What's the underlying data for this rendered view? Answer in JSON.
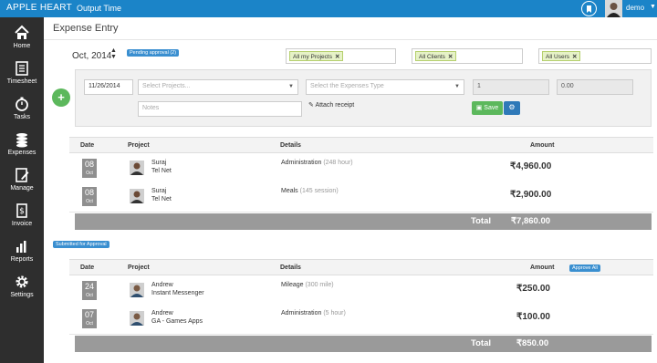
{
  "topbar": {
    "brand": "APPLE HEART",
    "subtitle": "Output Time",
    "user": "demo"
  },
  "sidebar": [
    {
      "label": "Home",
      "icon": "home-icon"
    },
    {
      "label": "Timesheet",
      "icon": "timesheet-icon"
    },
    {
      "label": "Tasks",
      "icon": "stopwatch-icon"
    },
    {
      "label": "Expenses",
      "icon": "coins-icon"
    },
    {
      "label": "Manage",
      "icon": "manage-icon"
    },
    {
      "label": "Invoice",
      "icon": "invoice-icon"
    },
    {
      "label": "Reports",
      "icon": "bar-chart-icon"
    },
    {
      "label": "Settings",
      "icon": "gear-icon"
    }
  ],
  "page": {
    "title": "Expense Entry",
    "month": "Oct, 2014",
    "pending_badge": "Pending approval (2)"
  },
  "filters": {
    "projects": "All my Projects",
    "clients": "All Clients",
    "users": "All Users"
  },
  "entry": {
    "date": "11/26/2014",
    "project_placeholder": "Select Projects...",
    "expense_type_placeholder": "Select the Expenses Type",
    "quantity": "1",
    "amount": "0.00",
    "notes_placeholder": "Notes",
    "attach_label": "Attach receipt",
    "save_label": "Save"
  },
  "table_headers": {
    "date": "Date",
    "project": "Project",
    "details": "Details",
    "amount": "Amount"
  },
  "pending": {
    "rows": [
      {
        "day": "08",
        "month": "Oct",
        "user": "Suraj",
        "project": "Tel Net",
        "detail": "Administration",
        "detail_note": "(248 hour)",
        "amount": "₹4,960.00"
      },
      {
        "day": "08",
        "month": "Oct",
        "user": "Suraj",
        "project": "Tel Net",
        "detail": "Meals",
        "detail_note": "(145 session)",
        "amount": "₹2,900.00"
      }
    ],
    "total_label": "Total",
    "total_value": "₹7,860.00"
  },
  "submitted": {
    "badge": "Submitted for Approval",
    "approve_all": "Approve All",
    "rows": [
      {
        "day": "24",
        "month": "Oct",
        "user": "Andrew",
        "project": "Instant Messenger",
        "detail": "Mileage",
        "detail_note": "(300 mile)",
        "amount": "₹250.00"
      },
      {
        "day": "07",
        "month": "Oct",
        "user": "Andrew",
        "project": "GA - Games Apps",
        "detail": "Administration",
        "detail_note": "(5 hour)",
        "amount": "₹100.00"
      }
    ],
    "total_label": "Total",
    "total_value": "₹850.00"
  }
}
